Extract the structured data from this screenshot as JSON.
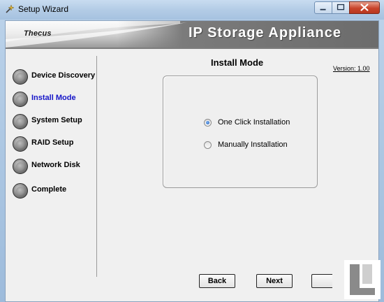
{
  "window": {
    "title": "Setup Wizard",
    "controls": [
      "minimize-icon",
      "maximize-icon",
      "close-icon"
    ]
  },
  "banner": {
    "logo": "Thecus",
    "title": "IP Storage Appliance"
  },
  "steps": [
    {
      "label": "Device Discovery",
      "active": false
    },
    {
      "label": "Install Mode",
      "active": true
    },
    {
      "label": "System Setup",
      "active": false
    },
    {
      "label": "RAID Setup",
      "active": false
    },
    {
      "label": "Network Disk",
      "active": false
    },
    {
      "label": "Complete",
      "active": false
    }
  ],
  "main": {
    "title": "Install Mode",
    "version": "Version: 1.00",
    "options": [
      {
        "label": "One Click Installation",
        "selected": true
      },
      {
        "label": "Manually Installation",
        "selected": false
      }
    ]
  },
  "buttons": {
    "back": "Back",
    "next": "Next",
    "cut_off": ""
  },
  "colors": {
    "active_step": "#1515c8",
    "titlebar": "#b3cce6",
    "close_button": "#c8442b"
  }
}
